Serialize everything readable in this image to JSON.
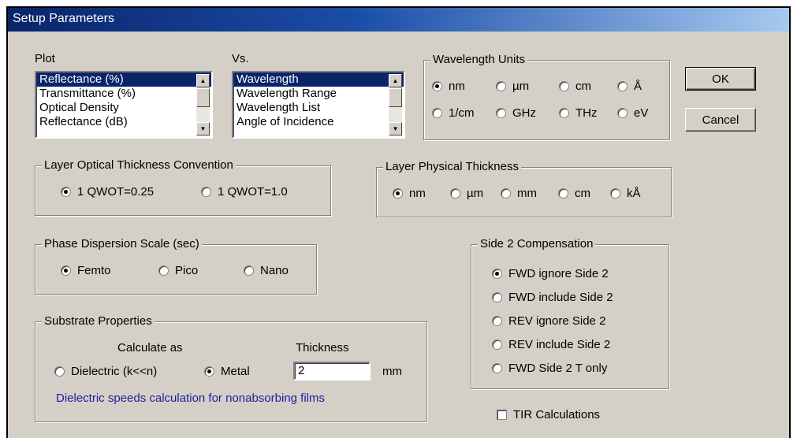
{
  "window": {
    "title": "Setup Parameters"
  },
  "plot": {
    "label": "Plot",
    "items": [
      "Reflectance (%)",
      "Transmittance (%)",
      "Optical Density",
      "Reflectance (dB)"
    ],
    "selected": 0
  },
  "vs": {
    "label": "Vs.",
    "items": [
      "Wavelength",
      "Wavelength Range",
      "Wavelength List",
      "Angle of Incidence"
    ],
    "selected": 0
  },
  "wavelength_units": {
    "label": "Wavelength Units",
    "options": [
      "nm",
      "µm",
      "cm",
      "Å",
      "1/cm",
      "GHz",
      "THz",
      "eV"
    ],
    "selected": "nm"
  },
  "buttons": {
    "ok": "OK",
    "cancel": "Cancel"
  },
  "optical_thickness": {
    "label": "Layer Optical Thickness Convention",
    "options": [
      "1 QWOT=0.25",
      "1 QWOT=1.0"
    ],
    "selected": "1 QWOT=0.25"
  },
  "physical_thickness": {
    "label": "Layer Physical Thickness",
    "options": [
      "nm",
      "µm",
      "mm",
      "cm",
      "kÅ"
    ],
    "selected": "nm"
  },
  "phase_dispersion": {
    "label": "Phase Dispersion Scale (sec)",
    "options": [
      "Femto",
      "Pico",
      "Nano"
    ],
    "selected": "Femto"
  },
  "side2": {
    "label": "Side 2 Compensation",
    "options": [
      "FWD ignore Side 2",
      "FWD include Side 2",
      "REV ignore Side 2",
      "REV include Side 2",
      "FWD Side 2 T only"
    ],
    "selected": "FWD ignore Side 2"
  },
  "substrate": {
    "label": "Substrate Properties",
    "calculate_as_label": "Calculate as",
    "thickness_label": "Thickness",
    "options": [
      "Dielectric (k<<n)",
      "Metal"
    ],
    "selected": "Metal",
    "thickness_value": "2",
    "thickness_unit": "mm",
    "note": "Dielectric speeds calculation for nonabsorbing films"
  },
  "tir": {
    "label": "TIR Calculations",
    "checked": false
  }
}
